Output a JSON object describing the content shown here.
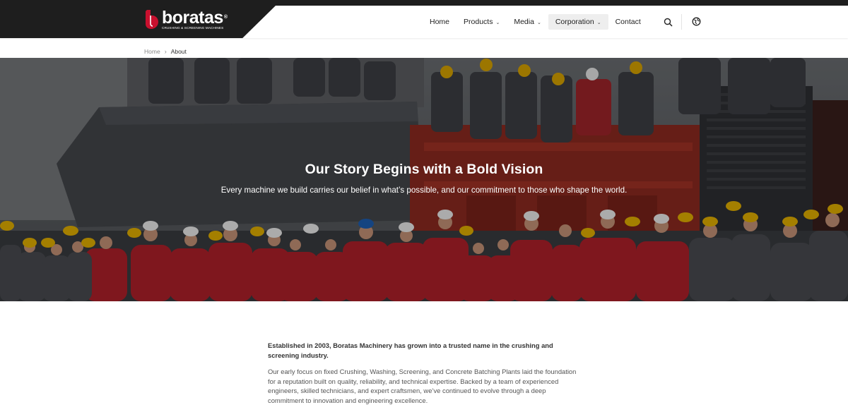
{
  "brand": {
    "name": "boratas",
    "registered": "®",
    "tagline": "CRUSHING & SCREENING MACHINES",
    "colors": {
      "red": "#c8102e",
      "dark": "#1e1e1e"
    }
  },
  "nav": {
    "items": [
      {
        "label": "Home",
        "has_dropdown": false,
        "active": false
      },
      {
        "label": "Products",
        "has_dropdown": true,
        "chevron": "⌄",
        "active": false
      },
      {
        "label": "Media",
        "has_dropdown": true,
        "chevron": "⌄",
        "active": false
      },
      {
        "label": "Corporation",
        "has_dropdown": true,
        "chevron": "⌄",
        "active": true
      },
      {
        "label": "Contact",
        "has_dropdown": false,
        "active": false
      }
    ],
    "icons": [
      "search-icon",
      "globe-icon"
    ]
  },
  "breadcrumb": {
    "home": "Home",
    "separator": "›",
    "current": "About"
  },
  "hero": {
    "title": "Our Story Begins with a Bold Vision",
    "subtitle": "Every machine we build carries our belief in what’s possible, and our commitment to those who shape the world."
  },
  "content": {
    "lead": "Established in 2003, Boratas Machinery has grown into a trusted name in the crushing and screening industry.",
    "paragraph": "Our early focus on fixed Crushing, Washing, Screening, and Concrete Batching Plants laid the foundation for a reputation built on quality, reliability, and technical expertise. Backed by a team of experienced engineers, skilled technicians, and expert craftsmen, we’ve continued to evolve through a deep commitment to innovation and engineering excellence."
  }
}
